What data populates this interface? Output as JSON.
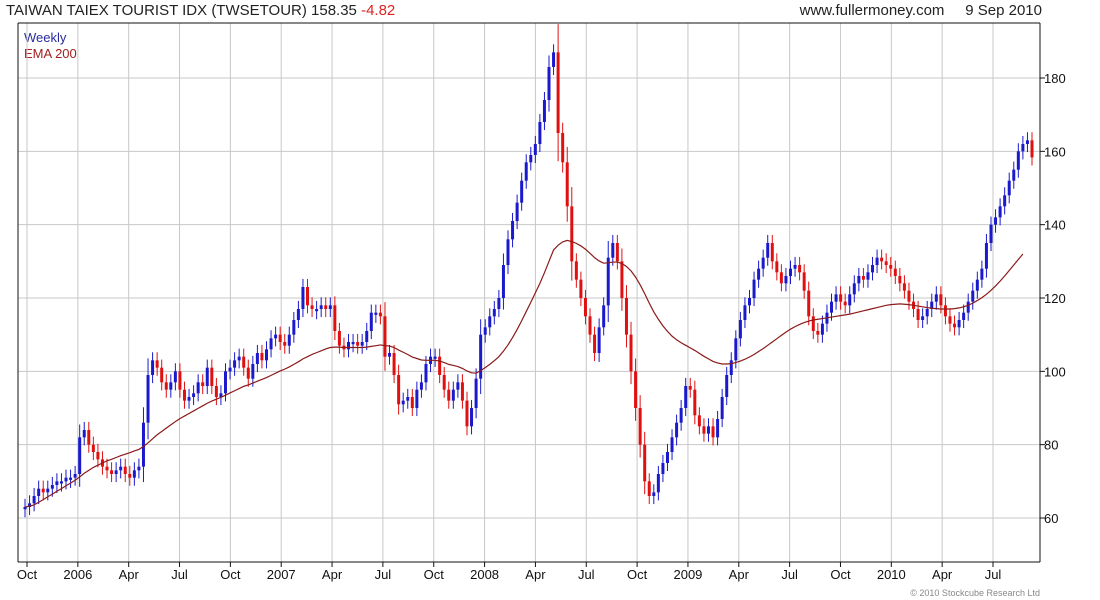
{
  "header": {
    "title_prefix": "TAIWAN TAIEX TOURIST IDX (TWSETOUR) 158.35",
    "title_change": "-4.82",
    "site": "www.fullermoney.com",
    "date": "9 Sep 2010"
  },
  "legend": {
    "weekly": "Weekly",
    "ema": "EMA 200"
  },
  "copyright": "© 2010 Stockcube Research Ltd",
  "colors": {
    "up": "#1a1acc",
    "down": "#e01010",
    "ema": "#8b1a1a",
    "grid": "#c8c8c8"
  },
  "chart_data": {
    "type": "candlestick",
    "title": "TAIWAN TAIEX TOURIST IDX (TWSETOUR) 158.35 -4.82",
    "ylim": [
      48,
      195
    ],
    "y_ticks": [
      60,
      80,
      100,
      120,
      140,
      160,
      180
    ],
    "grid": true,
    "x_ticks": [
      "Oct",
      "2006",
      "Apr",
      "Jul",
      "Oct",
      "2007",
      "Apr",
      "Jul",
      "Oct",
      "2008",
      "Apr",
      "Jul",
      "Oct",
      "2009",
      "Apr",
      "Jul",
      "Oct",
      "2010",
      "Apr",
      "Jul"
    ],
    "series": [
      {
        "name": "Weekly",
        "kind": "price",
        "values": [
          63,
          64,
          66,
          68,
          67,
          68,
          69,
          70,
          70,
          71,
          71,
          72,
          82,
          84,
          80,
          78,
          76,
          74,
          73,
          72,
          73,
          74,
          72,
          71,
          73,
          74,
          86,
          99,
          103,
          101,
          97,
          95,
          97,
          100,
          95,
          92,
          93,
          94,
          97,
          96,
          101,
          96,
          93,
          94,
          100,
          101,
          103,
          104,
          101,
          98,
          102,
          105,
          103,
          106,
          109,
          110,
          108,
          107,
          110,
          114,
          117,
          123,
          118,
          117,
          117,
          118,
          117,
          118,
          111,
          107,
          106,
          108,
          108,
          107,
          108,
          111,
          116,
          116,
          115,
          104,
          105,
          99,
          91,
          92,
          93,
          90,
          95,
          97,
          102,
          104,
          104,
          99,
          95,
          92,
          95,
          97,
          92,
          85,
          90,
          98,
          110,
          112,
          115,
          117,
          120,
          129,
          136,
          141,
          146,
          152,
          157,
          159,
          162,
          168,
          174,
          183,
          187,
          165,
          157,
          145,
          130,
          125,
          120,
          115,
          110,
          105,
          112,
          118,
          131,
          135,
          130,
          120,
          110,
          100,
          90,
          80,
          70,
          66,
          67,
          72,
          75,
          78,
          82,
          86,
          90,
          96,
          95,
          88,
          85,
          83,
          85,
          82,
          87,
          93,
          99,
          103,
          109,
          114,
          118,
          120,
          125,
          128,
          131,
          135,
          130,
          127,
          124,
          126,
          128,
          129,
          127,
          122,
          115,
          111,
          110,
          113,
          116,
          119,
          121,
          119,
          118,
          121,
          124,
          126,
          125,
          127,
          129,
          131,
          130,
          129,
          128,
          126,
          124,
          122,
          119,
          117,
          114,
          115,
          117,
          119,
          121,
          118,
          115,
          113,
          112,
          114,
          116,
          119,
          122,
          125,
          128,
          135,
          140,
          142,
          145,
          148,
          152,
          155,
          160,
          162,
          163,
          158.35
        ]
      },
      {
        "name": "EMA 200",
        "kind": "line",
        "values": [
          63,
          63.2,
          63.6,
          64.3,
          65,
          65.8,
          66.5,
          67.3,
          68,
          68.8,
          69.5,
          70.3,
          71.2,
          72.2,
          73,
          73.8,
          74.4,
          75,
          75.6,
          76,
          76.5,
          77,
          77.4,
          77.8,
          78.3,
          78.7,
          79.5,
          80.5,
          81.6,
          82.7,
          83.6,
          84.5,
          85.4,
          86.3,
          87.1,
          87.8,
          88.5,
          89.2,
          89.9,
          90.6,
          91.3,
          91.9,
          92.4,
          92.9,
          93.5,
          94.1,
          94.7,
          95.3,
          95.9,
          96.3,
          96.8,
          97.3,
          97.8,
          98.3,
          98.9,
          99.5,
          100.1,
          100.6,
          101.2,
          101.9,
          102.6,
          103.4,
          104,
          104.6,
          105.1,
          105.6,
          106.1,
          106.5,
          106.6,
          106.6,
          106.5,
          106.5,
          106.5,
          106.5,
          106.5,
          106.6,
          106.8,
          107,
          107.2,
          107,
          106.9,
          106.5,
          105.8,
          105.2,
          104.6,
          103.9,
          103.5,
          103.1,
          103,
          103,
          103,
          102.8,
          102.4,
          101.9,
          101.6,
          101.3,
          100.8,
          100.1,
          99.6,
          99.5,
          100.2,
          101,
          101.9,
          102.9,
          104,
          105.5,
          107.2,
          109.2,
          111.4,
          113.8,
          116.3,
          118.8,
          121.4,
          124,
          126.9,
          130,
          133.1,
          134.4,
          135.3,
          135.7,
          135.4,
          134.9,
          134.2,
          133.3,
          132.2,
          131,
          130.1,
          129.5,
          129.6,
          129.8,
          129.8,
          129.4,
          128.6,
          127.4,
          125.7,
          123.6,
          121.2,
          118.6,
          116.2,
          114.2,
          112.4,
          110.9,
          109.6,
          108.6,
          107.8,
          107.1,
          106.4,
          105.7,
          104.9,
          104.1,
          103.4,
          102.7,
          102.3,
          102,
          102,
          102.1,
          102.4,
          102.8,
          103.3,
          103.9,
          104.6,
          105.4,
          106.2,
          107.1,
          108,
          108.9,
          109.8,
          110.7,
          111.5,
          112.2,
          112.8,
          113.3,
          113.7,
          114,
          114.2,
          114.4,
          114.6,
          114.8,
          115,
          115.2,
          115.4,
          115.6,
          115.9,
          116.2,
          116.5,
          116.8,
          117.1,
          117.4,
          117.7,
          118,
          118.2,
          118.3,
          118.4,
          118.3,
          118.2,
          118,
          117.8,
          117.6,
          117.4,
          117.2,
          117.1,
          117,
          117,
          117,
          117.1,
          117.3,
          117.6,
          118,
          118.6,
          119.3,
          120.1,
          121,
          122.1,
          123.3,
          124.6,
          126,
          127.5,
          129,
          130.5,
          132
        ]
      }
    ]
  }
}
